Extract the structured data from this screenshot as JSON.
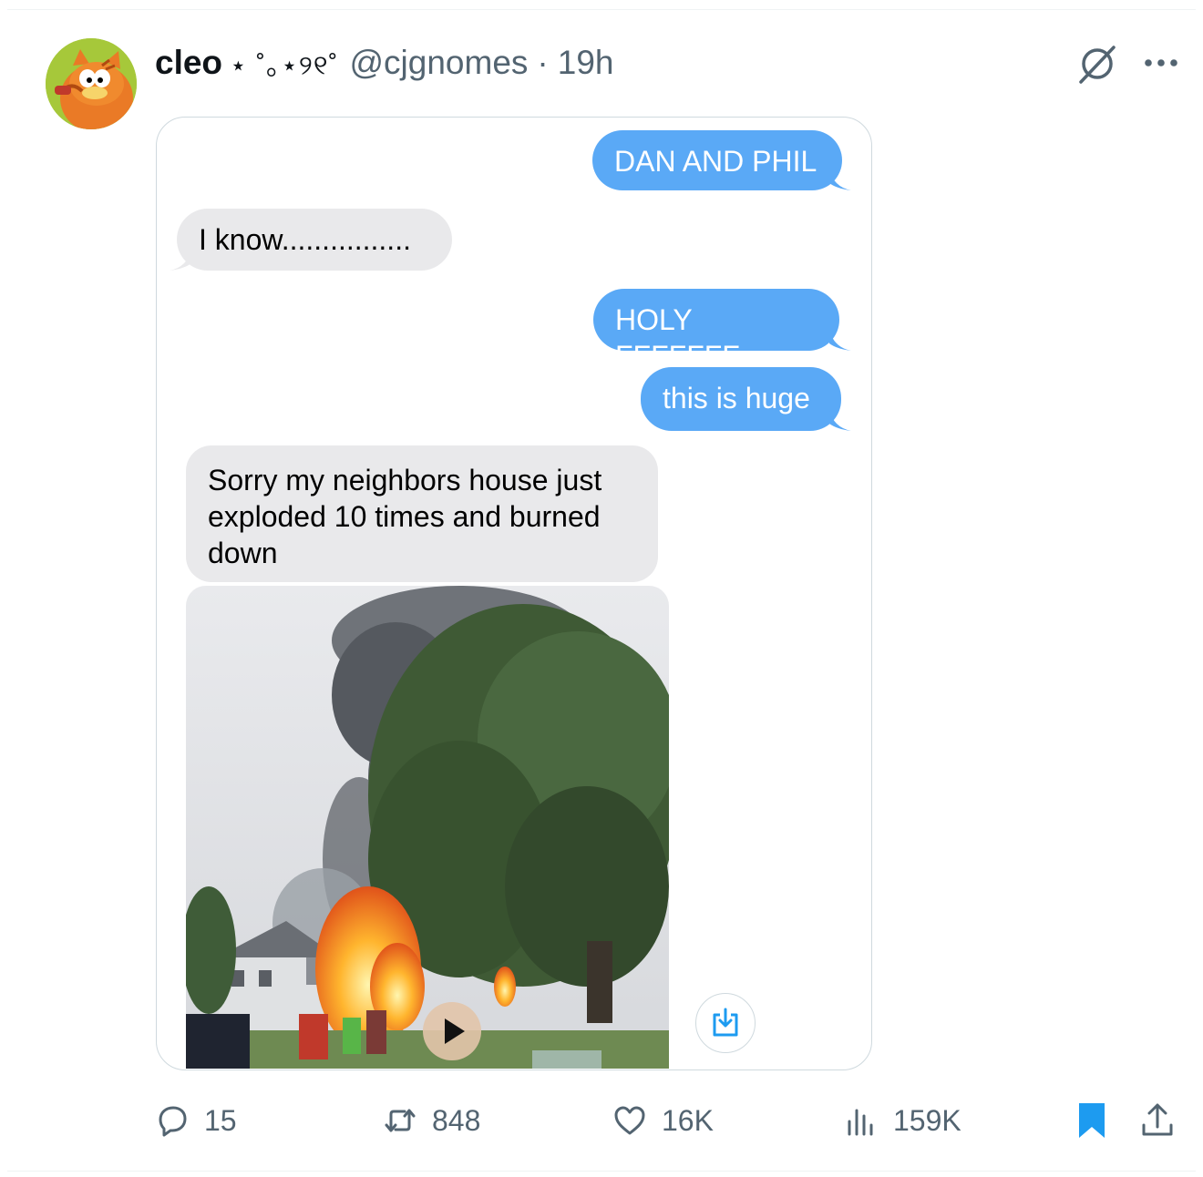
{
  "tweet": {
    "author_name": "cleo",
    "name_decoration": "⋆ ˚｡⋆୨୧˚",
    "handle": "@cjgnomes",
    "separator": "·",
    "time": "19h",
    "avatar_icon": "garfield-avatar",
    "top_icons": [
      "grok-icon",
      "more-icon"
    ]
  },
  "messages": [
    {
      "side": "outgoing",
      "text": "DAN AND PHIL"
    },
    {
      "side": "incoming",
      "text": "I know................"
    },
    {
      "side": "outgoing",
      "text": "HOLY FFFFFFF"
    },
    {
      "side": "outgoing",
      "text": "this is huge"
    },
    {
      "side": "incoming",
      "text": "Sorry my neighbors house just exploded 10 times and burned down"
    }
  ],
  "media": {
    "type": "video-thumbnail",
    "play_icon": "play-icon",
    "download_icon": "download-icon"
  },
  "actions": {
    "replies": "15",
    "reposts": "848",
    "likes": "16K",
    "views": "159K",
    "bookmarked": true
  },
  "colors": {
    "outgoing_bubble": "#5aa9f6",
    "incoming_bubble": "#e9e9eb",
    "accent_blue": "#1d9bf0",
    "muted_text": "#536471"
  }
}
